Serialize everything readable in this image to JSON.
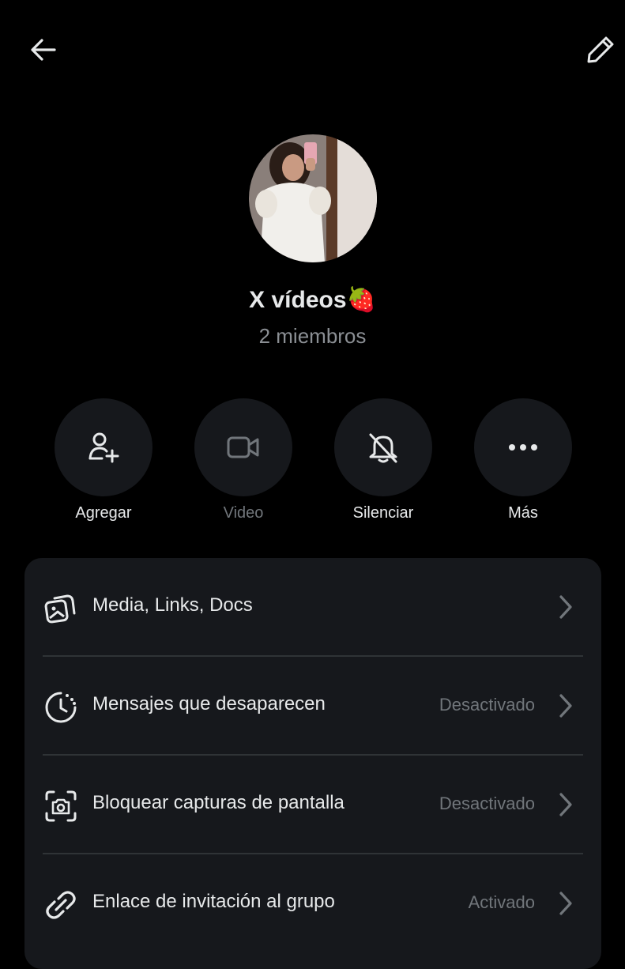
{
  "header": {
    "back_icon": "arrow-left-icon",
    "edit_icon": "pencil-icon"
  },
  "group": {
    "name": "X vídeos🍓",
    "members": "2 miembros"
  },
  "actions": [
    {
      "label": "Agregar",
      "icon": "add-person-icon",
      "enabled": true
    },
    {
      "label": "Video",
      "icon": "video-camera-icon",
      "enabled": false
    },
    {
      "label": "Silenciar",
      "icon": "bell-off-icon",
      "enabled": true
    },
    {
      "label": "Más",
      "icon": "more-dots-icon",
      "enabled": true
    }
  ],
  "settings": [
    {
      "label": "Media, Links, Docs",
      "value": "",
      "icon": "media-stack-icon"
    },
    {
      "label": "Mensajes que desaparecen",
      "value": "Desactivado",
      "icon": "timer-icon"
    },
    {
      "label": "Bloquear capturas de pantalla",
      "value": "Desactivado",
      "icon": "screenshot-camera-icon"
    },
    {
      "label": "Enlace de invitación al grupo",
      "value": "Activado",
      "icon": "link-icon"
    }
  ],
  "colors": {
    "background": "#000000",
    "card": "#16181c",
    "text": "#e7e9ea",
    "muted": "#71767b"
  }
}
